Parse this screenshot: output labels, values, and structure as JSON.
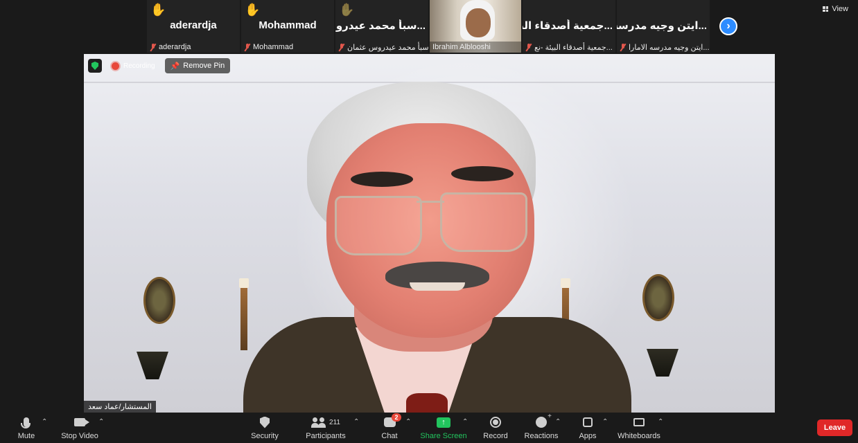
{
  "view_button": {
    "label": "View"
  },
  "thumbnails": [
    {
      "display_name": "aderardja",
      "footer_name": "aderardja",
      "hand": "✋",
      "hand_color": "#f5b800"
    },
    {
      "display_name": "Mohammad",
      "footer_name": "Mohammad",
      "hand": "✋",
      "hand_color": "#f5b800"
    },
    {
      "display_name": "...سبأ محمد عيدرو",
      "footer_name": "سبأ محمد عيدروس عثمان",
      "hand": "✋",
      "hand_color": "#7a5230"
    },
    {
      "footer_name": "Ibrahim Alblooshi",
      "video": true
    },
    {
      "display_name": "...جمعية أصدقاء البي",
      "footer_name": "...جمعية أصدقاء البيئة -نع"
    },
    {
      "display_name": "...ايتن وجيه مدرسه ال",
      "footer_name": "...ايتن وجيه مدرسه الامارا"
    }
  ],
  "main": {
    "recording_label": "Recording",
    "remove_pin_label": "Remove Pin",
    "speaker_name": "المستشار/عماد سعد"
  },
  "toolbar": {
    "mute": "Mute",
    "stop_video": "Stop Video",
    "security": "Security",
    "participants": "Participants",
    "participants_count": "211",
    "chat": "Chat",
    "chat_badge": "2",
    "share_screen": "Share Screen",
    "record": "Record",
    "reactions": "Reactions",
    "apps": "Apps",
    "whiteboards": "Whiteboards",
    "leave": "Leave"
  },
  "colors": {
    "background": "#1a1a1a",
    "accent_blue": "#2d8cff",
    "share_green": "#22c55e",
    "leave_red": "#e02828",
    "muted_red": "#e2574c"
  },
  "icons": [
    "view-grid-icon",
    "raised-hand-icon",
    "mic-muted-icon",
    "next-page-icon",
    "shield-icon",
    "recording-dot-icon",
    "pin-icon",
    "microphone-icon",
    "camera-icon",
    "security-icon",
    "participants-icon",
    "chat-icon",
    "share-screen-icon",
    "record-icon",
    "reactions-icon",
    "apps-icon",
    "whiteboards-icon"
  ]
}
